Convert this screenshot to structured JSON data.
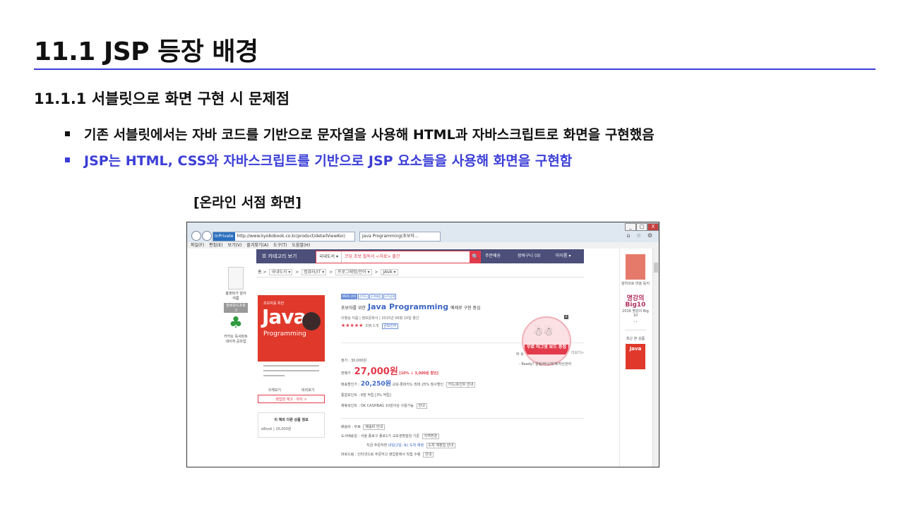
{
  "slide": {
    "title": "11.1 JSP 등장 배경",
    "subtitle": "11.1.1 서블릿으로 화면 구현 시 문제점",
    "bullets": [
      "기존 서블릿에서는 자바 코드를 기반으로 문자열을 사용해 HTML과 자바스크립트로 화면을 구현했음",
      "JSP는 HTML, CSS와 자바스크립트를 기반으로 JSP 요소들을 사용해 화면을 구현함"
    ],
    "caption": "[온라인 서점 화면]",
    "accent_color": "#3b3ed6"
  },
  "browser": {
    "inprivate": "InPrivate",
    "address": "http://www.kyobobook.co.kr/product/detailViewKor/",
    "tab_title": "Java Programming(초보자...",
    "menu": [
      "파일(F)",
      "편집(E)",
      "보기(V)",
      "즐겨찾기(A)",
      "도구(T)",
      "도움말(H)"
    ],
    "window_controls": [
      "_",
      "□",
      "X"
    ],
    "toolbar_icons": "⌂ ☆ ⚙"
  },
  "store": {
    "category_button": "☰  카테고리 보기",
    "search_scope": "국내도서 ▾",
    "search_placeholder": "코딩 초보 필독서 <자료> 출간",
    "search_icon": "🔍",
    "nav": [
      "주문배송",
      "장바구니 (0)",
      "마이룸 ▾"
    ],
    "breadcrumb": [
      "홈",
      "국내도서 ▾",
      "컴퓨터/IT ▾",
      "프로그래밍/언어 ▾",
      "JAVA ▾"
    ],
    "left_side": {
      "book_caption": "홍퍼퍼가 알아 여름",
      "badge": "슬로보드프로그",
      "tree_caption": "카카오 독서파트 네이처 공유업"
    },
    "cover": {
      "top": "초보자를 위한",
      "java": "Java",
      "programming": "Programming"
    },
    "under_cover": [
      "크게보기",
      "미리보기"
    ],
    "stock_button": "영업점 재고 · 위치  >",
    "other_box": {
      "title": "이 책의 다른 상품 정보",
      "row": "eBook | 26,000원"
    },
    "tags": [
      "MD의 선택",
      "신작도",
      "무료배송",
      "소득공제"
    ],
    "book_title_pre": "초보자를 위한",
    "book_title_main": "Java Programming",
    "book_title_post": "예제로 구현 중심",
    "author": "이병승 지음 | 정보문화사 | 2015년 09월 10일 출간",
    "stars": "★★★★★",
    "rating_rest": "리뷰 1개",
    "rating_chip": "큰보인키",
    "list_price": "정가 : 30,000원",
    "sale_label": "판매가 :",
    "sale_price": "27,000원",
    "sale_discount": "[10% ↓ 3,000원 할인]",
    "member_label": "매표할인가 :",
    "member_price": "20,250원",
    "member_note": "교보·롯데카드 최대 25% 청구할인",
    "member_chip": "카드/포인트 안내",
    "point": "통합포인트 : 8점 적립 [3% 적립]",
    "extra_point": "제휴포인트 : OK CASHBAG 10원이상 사용가능",
    "extra_chip": "안내",
    "shipping": "배송비 : 무료",
    "shipping_chip": "배송비 안내",
    "delivery": "도서배송일 : 서울 종로구 종로1가 교보생명빌딩 기준",
    "delivery_chip": "지역변경",
    "delivery2": "지금 주문하면",
    "delivery2_blue": "내일(2일, 토) 도착 예정",
    "delivery2_chip": "도착 예정일 안내",
    "pickup": "바로드림 : 인터넷으로 주문하고 영업점에서 직접 수령",
    "pickup_chip": "안내",
    "promo_banner": "무료 마그넷 보드 증정",
    "promo_side": "배 송",
    "promo_more": "더보기>",
    "promo_sub": "- Ready? 칼림/버닝/회계/자산관리",
    "right_col": {
      "book1_caption": "잘하므로 마을 둥지",
      "bigten_title": "명강의 Big10",
      "bigten_year": "2016 명강의 Big 10",
      "arrows": "‹ ›",
      "recent": "최근 본 상품",
      "book2": "Java"
    }
  }
}
